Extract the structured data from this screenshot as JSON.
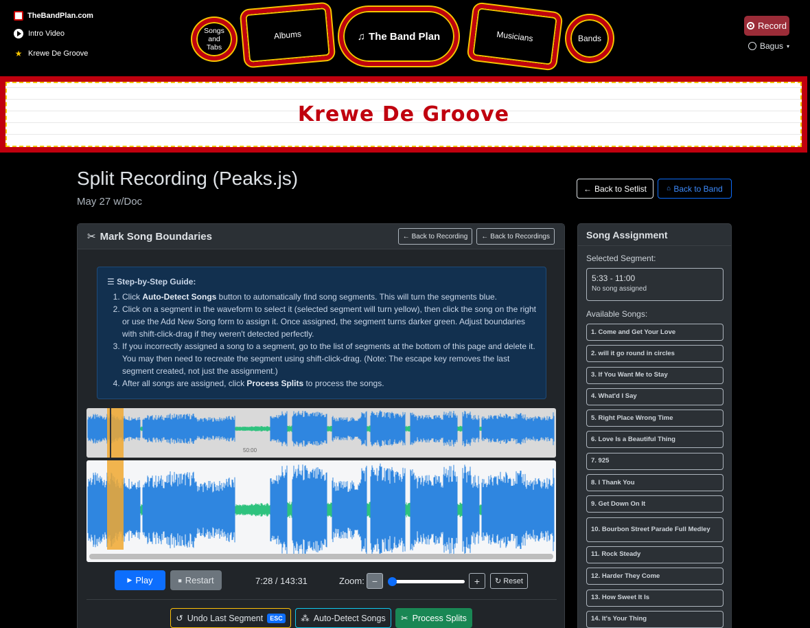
{
  "nav": {
    "brand": "TheBandPlan.com",
    "intro_video": "Intro Video",
    "band_link": "Krewe De Groove",
    "marquee": {
      "songs_and_tabs": "Songs and Tabs",
      "albums": "Albums",
      "the_band_plan": "The Band Plan",
      "musicians": "Musicians",
      "bands": "Bands"
    },
    "record_label": "Record",
    "user_name": "Bagus"
  },
  "banner": {
    "title": "Krewe De Groove"
  },
  "header": {
    "title": "Split Recording (Peaks.js)",
    "subtitle": "May 27 w/Doc",
    "back_to_setlist": "Back to Setlist",
    "back_to_band": "Back to Band"
  },
  "card": {
    "title": "Mark Song Boundaries",
    "back_to_recording": "Back to Recording",
    "back_to_recordings": "Back to Recordings"
  },
  "guide": {
    "title": "Step-by-Step Guide:",
    "steps": [
      {
        "pre": "Click ",
        "bold": "Auto-Detect Songs",
        "post": " button to automatically find song segments. This will turn the segments blue."
      },
      {
        "pre": "Click on a segment in the waveform to select it (selected segment will turn yellow), then click the song on the right or use the Add New Song form to assign it. Once assigned, the segment turns darker green. Adjust boundaries with shift-click-drag if they weren't detected perfectly.",
        "bold": "",
        "post": ""
      },
      {
        "pre": "If you incorrectly assigned a song to a segment, go to the list of segments at the bottom of this page and delete it. You may then need to recreate the segment using shift-click-drag. (Note: The escape key removes the last segment created, not just the assignment.)",
        "bold": "",
        "post": ""
      },
      {
        "pre": "After all songs are assigned, click ",
        "bold": "Process Splits",
        "post": " to process the songs."
      }
    ]
  },
  "waveform": {
    "overview_ticks": [
      "50:00"
    ],
    "segment_color": "#f0a830",
    "wave_color": "#2f86e0",
    "unassigned_color": "#2ec27e"
  },
  "controls": {
    "play_label": "Play",
    "restart_label": "Restart",
    "time": "7:28 / 143:31",
    "zoom_label": "Zoom:",
    "zoom_level": 0.0,
    "reset_label": "Reset"
  },
  "actions": {
    "undo_label": "Undo Last Segment",
    "undo_key": "ESC",
    "auto_detect_label": "Auto-Detect Songs",
    "process_label": "Process Splits"
  },
  "side": {
    "title": "Song Assignment",
    "selected_label": "Selected Segment:",
    "selected_time": "5:33 - 11:00",
    "selected_state": "No song assigned",
    "available_label": "Available Songs:",
    "songs": [
      "1. Come and Get Your Love",
      "2. will it go round in circles",
      "3. If You Want Me to Stay",
      "4. What'd I Say",
      "5. Right Place Wrong Time",
      "6. Love Is a Beautiful Thing",
      "7. 925",
      "8. I Thank You",
      "9. Get Down On It",
      "10. Bourbon Street Parade Full Medley",
      "11. Rock Steady",
      "12. Harder They Come",
      "13. How Sweet It Is",
      "14. It's Your Thing"
    ]
  }
}
